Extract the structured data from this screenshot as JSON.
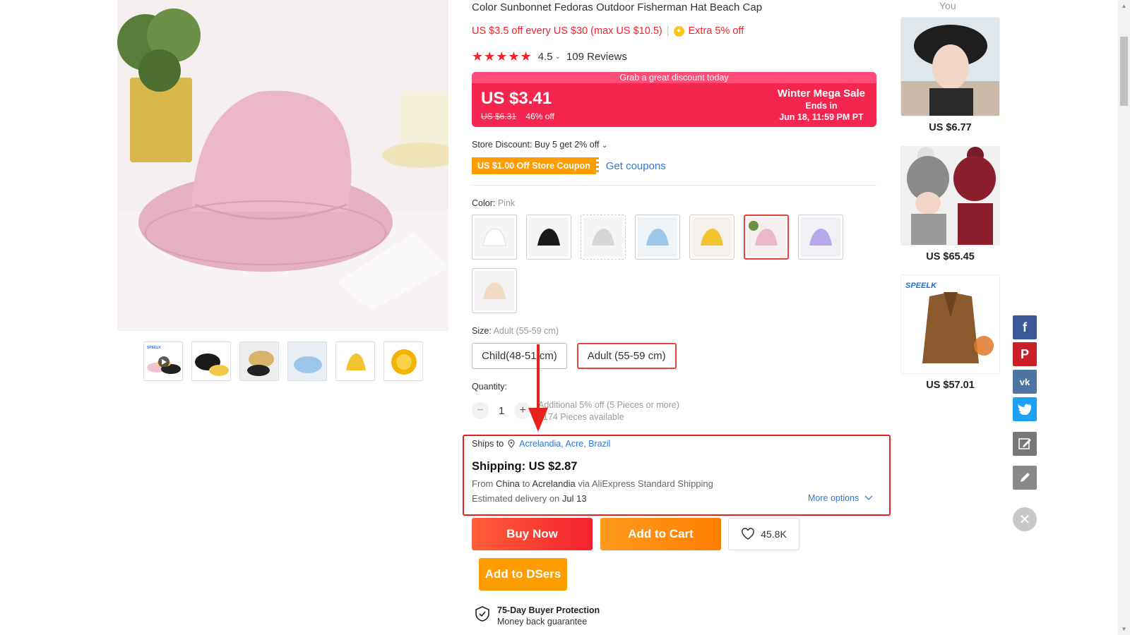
{
  "product": {
    "title": "Color Sunbonnet Fedoras Outdoor Fisherman Hat Beach Cap",
    "promo_main": "US $3.5 off every US $30 (max US $10.5)",
    "promo_sep": "|",
    "promo_extra": "Extra 5% off",
    "rating_value": "4.5",
    "reviews": "109 Reviews"
  },
  "sale": {
    "top_text": "Grab a great discount today",
    "price": "US $3.41",
    "original_price": "US $6.31",
    "discount": "46% off",
    "event_name": "Winter Mega Sale",
    "ends_label": "Ends in",
    "ends_time": "Jun 18, 11:59 PM PT"
  },
  "store": {
    "discount_text": "Store Discount: Buy 5 get 2% off",
    "coupon_label": "US $1.00 Off Store Coupon",
    "get_coupons": "Get coupons"
  },
  "color": {
    "label": "Color:",
    "value": "Pink",
    "swatches": [
      "white",
      "black",
      "grey",
      "blue",
      "yellow",
      "pink",
      "purple",
      "beige"
    ],
    "selected": "pink"
  },
  "size": {
    "label": "Size:",
    "value": "Adult (55-59 cm)",
    "options": [
      "Child(48-51 cm)",
      "Adult (55-59 cm)"
    ]
  },
  "quantity": {
    "label": "Quantity:",
    "value": "1",
    "minus": "−",
    "plus": "+",
    "info_1": "Additional 5% off (5 Pieces or more)",
    "info_2": "3174 Pieces available"
  },
  "shipping": {
    "ships_to_label": "Ships to",
    "location": "Acrelandia, Acre, Brazil",
    "cost": "Shipping: US $2.87",
    "from_prefix": "From",
    "from_country": "China",
    "to_word": "to",
    "to_city": "Acrelandia",
    "via": "via AliExpress Standard Shipping",
    "est_prefix": "Estimated delivery on",
    "est_date": "Jul 13",
    "more_options": "More options"
  },
  "actions": {
    "buy_now": "Buy Now",
    "add_to_cart": "Add to Cart",
    "wishlist_count": "45.8K",
    "add_to_dsers": "Add to DSers"
  },
  "protection": {
    "title": "75-Day Buyer Protection",
    "subtitle": "Money back guarantee"
  },
  "recommendations": {
    "header": "You",
    "items": [
      {
        "price": "US $6.77"
      },
      {
        "price": "US $65.45"
      },
      {
        "price": "US $57.01",
        "brand": "SPEELK"
      }
    ]
  },
  "thumbnails": {
    "first_brand": "SPEELK"
  },
  "colors": {
    "accent_red": "#f5222d",
    "sale_red": "#f4264f",
    "link_blue": "#2e78d6",
    "orange": "#ff9c00",
    "highlight_box": "#e8211c"
  }
}
